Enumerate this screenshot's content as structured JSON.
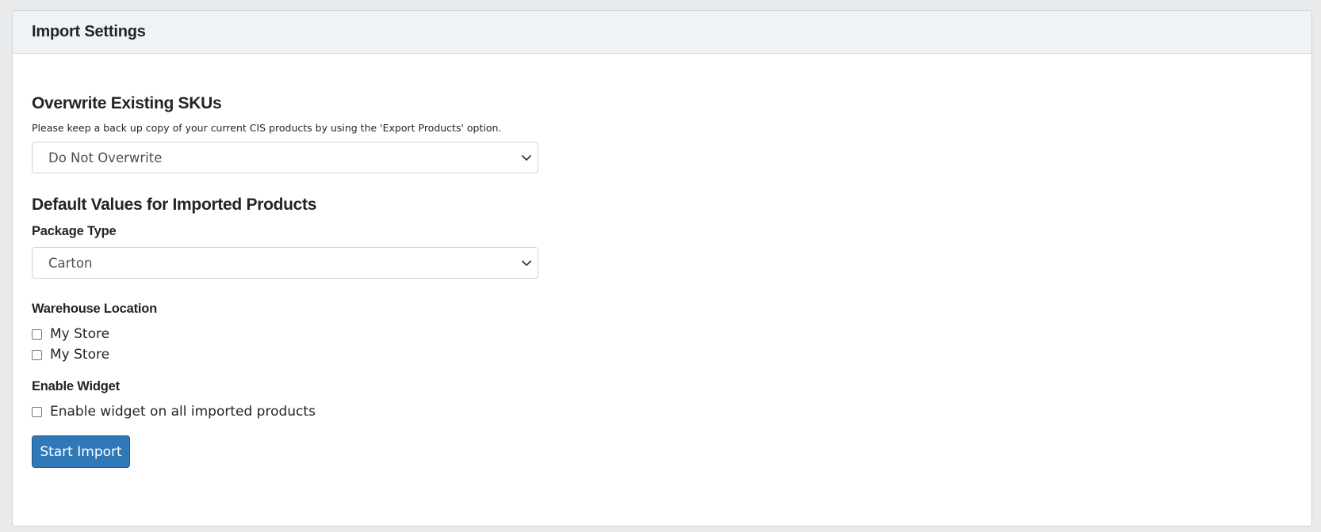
{
  "card": {
    "title": "Import Settings"
  },
  "overwrite": {
    "heading": "Overwrite Existing SKUs",
    "help": "Please keep a back up copy of your current CIS products by using the 'Export Products' option.",
    "selected": "Do Not Overwrite",
    "icon": "chevron-down-icon"
  },
  "defaults": {
    "heading": "Default Values for Imported Products",
    "package_type": {
      "label": "Package Type",
      "selected": "Carton",
      "icon": "chevron-down-icon"
    },
    "warehouse": {
      "label": "Warehouse Location",
      "options": [
        {
          "label": "My Store",
          "checked": false
        },
        {
          "label": "My Store",
          "checked": false
        }
      ]
    },
    "widget": {
      "label": "Enable Widget",
      "option": {
        "label": "Enable widget on all imported products",
        "checked": false
      }
    }
  },
  "actions": {
    "start_import": "Start Import"
  },
  "colors": {
    "primary_button": "#3079b8",
    "header_bg": "#eff3f6",
    "page_bg": "#e9eaec"
  }
}
